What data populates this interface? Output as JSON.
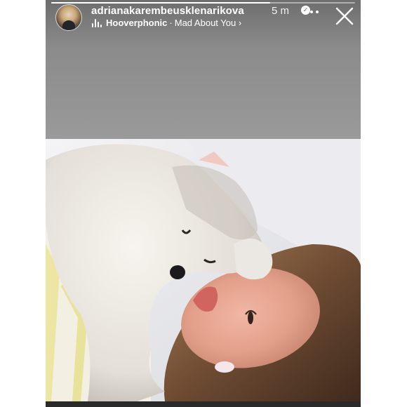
{
  "story": {
    "progress": 0.72,
    "username": "adrianakarembeusklenarikova",
    "verified": true,
    "time_ago": "5 m",
    "song": {
      "artist": "Hooverphonic",
      "separator": "·",
      "title": "Mad About You",
      "chevron": "›"
    },
    "icons": {
      "more": "more-options-icon",
      "close": "close-icon",
      "music": "music-bars-icon",
      "verified": "verified-badge-icon"
    },
    "colors": {
      "header_bg": "#8b8b8b",
      "text": "#ffffff"
    }
  }
}
